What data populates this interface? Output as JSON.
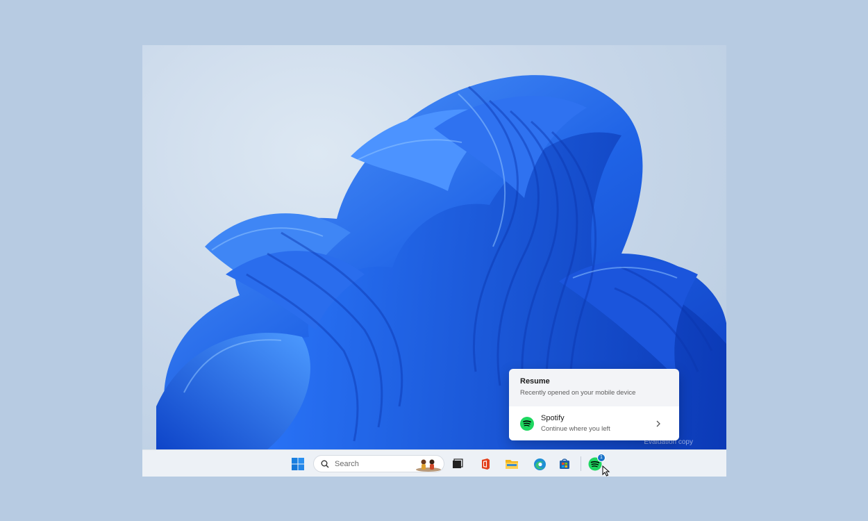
{
  "desktop": {
    "watermark": "Evaluation copy"
  },
  "resume_flyout": {
    "title": "Resume",
    "subtitle": "Recently opened on your mobile device",
    "item": {
      "name": "Spotify",
      "description": "Continue where you left",
      "icon": "spotify-icon",
      "chevron": "chevron-right-icon"
    }
  },
  "taskbar": {
    "search_placeholder": "Search",
    "items": [
      {
        "name": "start",
        "icon": "windows-logo-icon"
      },
      {
        "name": "search",
        "icon": "search-icon"
      },
      {
        "name": "people",
        "icon": "people-icon"
      },
      {
        "name": "task-view",
        "icon": "task-view-icon"
      },
      {
        "name": "office",
        "icon": "office-icon"
      },
      {
        "name": "file-explorer",
        "icon": "folder-icon"
      },
      {
        "name": "edge",
        "icon": "edge-icon"
      },
      {
        "name": "store",
        "icon": "store-icon"
      },
      {
        "name": "spotify",
        "icon": "spotify-icon",
        "badge": "1"
      }
    ]
  },
  "colors": {
    "accent": "#1d5fe0",
    "spotify_green": "#1ed760",
    "taskbar": "#edf1f6"
  }
}
